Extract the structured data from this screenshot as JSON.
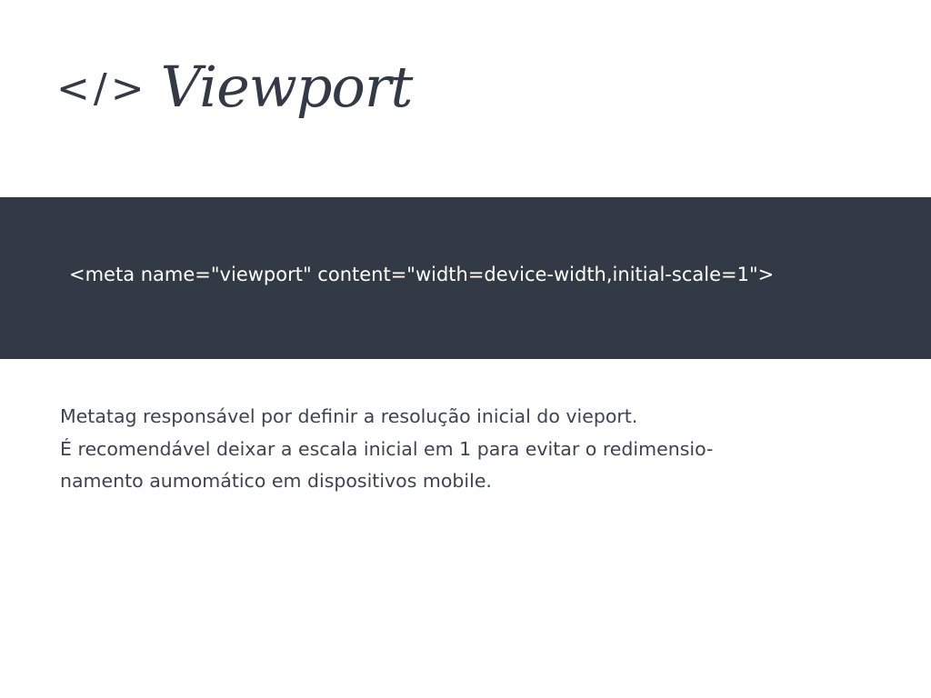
{
  "header": {
    "symbol": "</>",
    "title": "Viewport"
  },
  "code": {
    "snippet": "<meta name=\"viewport\" content=\"width=device-width,initial-scale=1\">"
  },
  "description": {
    "lines": [
      "Metatag responsável por definir a resolução inicial do vieport.",
      "É recomendável deixar a escala inicial em 1 para evitar o redimensio-",
      "namento aumomático em dispositivos mobile."
    ]
  },
  "colors": {
    "primary_dark": "#333a45",
    "background": "#ffffff",
    "code_text": "#ffffff"
  }
}
